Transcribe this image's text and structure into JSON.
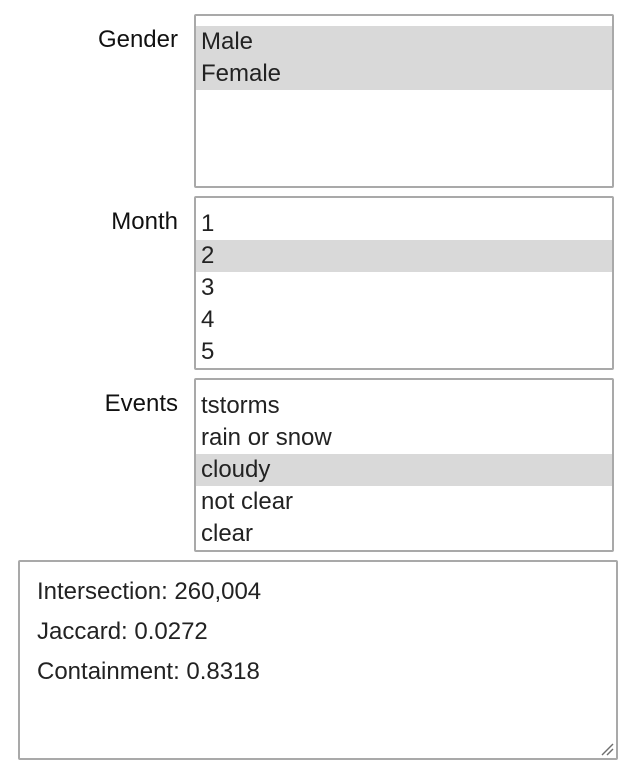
{
  "filters": {
    "gender": {
      "label": "Gender",
      "options": [
        "Male",
        "Female"
      ],
      "selected": [
        0,
        1
      ]
    },
    "month": {
      "label": "Month",
      "options": [
        "1",
        "2",
        "3",
        "4",
        "5"
      ],
      "selected": [
        1
      ]
    },
    "events": {
      "label": "Events",
      "options": [
        "tstorms",
        "rain or snow",
        "cloudy",
        "not clear",
        "clear"
      ],
      "selected": [
        2
      ]
    }
  },
  "results": {
    "intersection": "Intersection: 260,004",
    "jaccard": "Jaccard: 0.0272",
    "containment": "Containment: 0.8318"
  },
  "icons": {
    "resize_grip": "resize-grip-icon"
  }
}
